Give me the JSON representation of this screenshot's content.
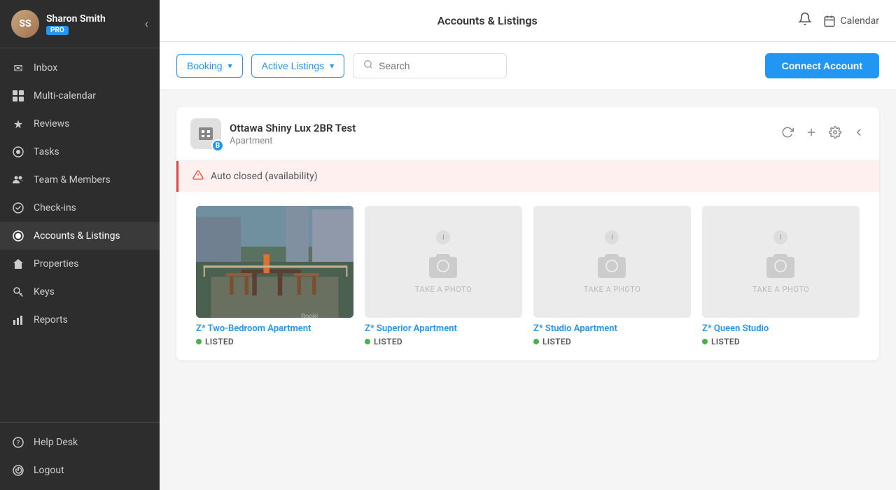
{
  "sidebar": {
    "user": {
      "name": "Sharon Smith",
      "badge": "PRO",
      "initials": "SS"
    },
    "nav_items": [
      {
        "id": "inbox",
        "label": "Inbox",
        "icon": "✉",
        "active": false
      },
      {
        "id": "multi-calendar",
        "label": "Multi-calendar",
        "icon": "⊞",
        "active": false
      },
      {
        "id": "reviews",
        "label": "Reviews",
        "icon": "★",
        "active": false
      },
      {
        "id": "tasks",
        "label": "Tasks",
        "icon": "✓",
        "active": false
      },
      {
        "id": "team-members",
        "label": "Team & Members",
        "icon": "👥",
        "active": false
      },
      {
        "id": "check-ins",
        "label": "Check-ins",
        "icon": "🍽",
        "active": false
      },
      {
        "id": "accounts-listings",
        "label": "Accounts & Listings",
        "icon": "●",
        "active": true
      },
      {
        "id": "properties",
        "label": "Properties",
        "icon": "⌂",
        "active": false
      },
      {
        "id": "keys",
        "label": "Keys",
        "icon": "🎸",
        "active": false
      },
      {
        "id": "reports",
        "label": "Reports",
        "icon": "📊",
        "active": false
      }
    ],
    "footer_items": [
      {
        "id": "help-desk",
        "label": "Help Desk",
        "icon": "?",
        "active": false
      },
      {
        "id": "logout",
        "label": "Logout",
        "icon": "⏻",
        "active": false
      }
    ]
  },
  "topbar": {
    "title": "Accounts & Listings",
    "calendar_label": "Calendar"
  },
  "toolbar": {
    "booking_label": "Booking",
    "listings_label": "Active Listings",
    "search_placeholder": "Search",
    "connect_label": "Connect Account"
  },
  "account": {
    "name": "Ottawa Shiny Lux 2BR Test",
    "type": "Apartment",
    "badge_letter": "B",
    "alert": "Auto closed (availability)"
  },
  "listings": [
    {
      "id": "listing-1",
      "name": "Z* Two-Bedroom Apartment",
      "status": "LISTED",
      "has_photo": true,
      "image_alt": "Balcony view apartment"
    },
    {
      "id": "listing-2",
      "name": "Z* Superior Apartment",
      "status": "LISTED",
      "has_photo": false
    },
    {
      "id": "listing-3",
      "name": "Z* Studio Apartment",
      "status": "LISTED",
      "has_photo": false
    },
    {
      "id": "listing-4",
      "name": "Z* Queen Studio",
      "status": "LISTED",
      "has_photo": false
    }
  ],
  "icons": {
    "inbox": "✉",
    "multi_calendar": "▦",
    "reviews": "★",
    "tasks": "✔",
    "team_members": "⊙",
    "check_ins": "⊕",
    "accounts_listings": "⊗",
    "properties": "⌂",
    "keys": "⚿",
    "reports": "▮▮",
    "help_desk": "?",
    "logout": "⏻",
    "bell": "🔔",
    "calendar": "📅",
    "chevron_left": "‹",
    "refresh": "↻",
    "plus": "+",
    "gear": "⚙",
    "chevron_left_sm": "‹",
    "info": "ℹ",
    "camera": "📷",
    "alert_triangle": "⚠"
  },
  "colors": {
    "sidebar_bg": "#2d2d2d",
    "accent_blue": "#2196F3",
    "active_nav": "#3a3a3a",
    "alert_red": "#f44336",
    "alert_bg": "#fff0f0",
    "status_green": "#4CAF50"
  }
}
